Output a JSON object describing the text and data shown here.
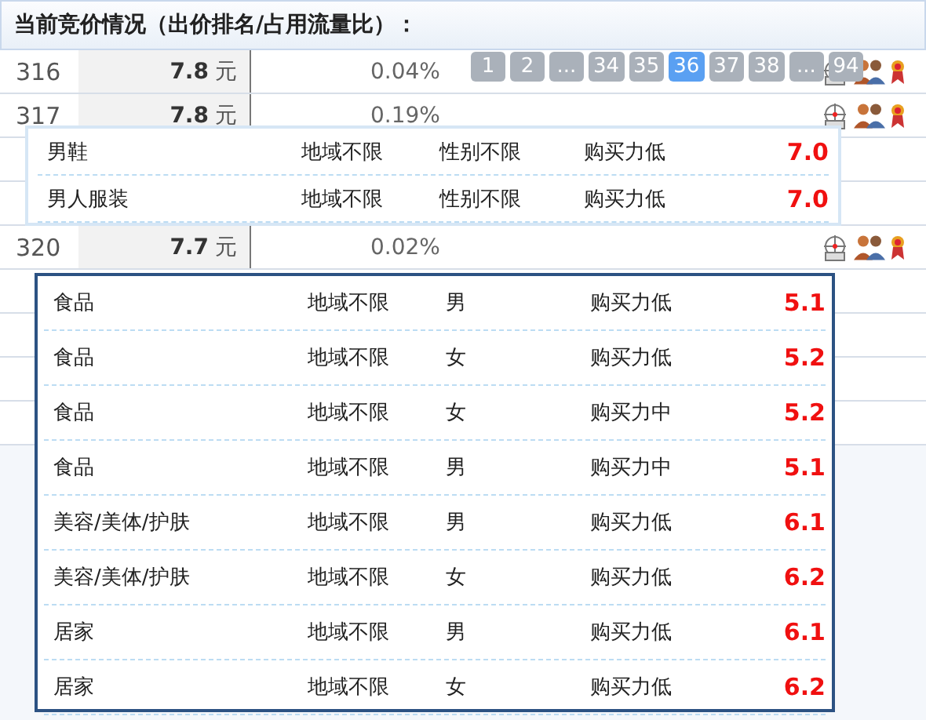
{
  "title": "当前竞价情况（出价排名/占用流量比）：",
  "rows": [
    {
      "rank": "316",
      "price": "7.8",
      "unit": "元",
      "share": "0.04%"
    },
    {
      "rank": "317",
      "price": "7.8",
      "unit": "元",
      "share": "0.19%"
    },
    {
      "rank": "320",
      "price": "7.7",
      "unit": "元",
      "share": "0.02%"
    }
  ],
  "pagination": [
    {
      "label": "1",
      "selected": false
    },
    {
      "label": "2",
      "selected": false
    },
    {
      "label": "...",
      "selected": false
    },
    {
      "label": "34",
      "selected": false
    },
    {
      "label": "35",
      "selected": false
    },
    {
      "label": "36",
      "selected": true
    },
    {
      "label": "37",
      "selected": false
    },
    {
      "label": "38",
      "selected": false
    },
    {
      "label": "...",
      "selected": false
    },
    {
      "label": "94",
      "selected": false
    }
  ],
  "popup_top": [
    {
      "category": "男鞋",
      "region": "地域不限",
      "gender": "性别不限",
      "power": "购买力低",
      "price": "7.0"
    },
    {
      "category": "男人服装",
      "region": "地域不限",
      "gender": "性别不限",
      "power": "购买力低",
      "price": "7.0"
    }
  ],
  "popup_main": [
    {
      "category": "食品",
      "region": "地域不限",
      "gender": "男",
      "power": "购买力低",
      "price": "5.1"
    },
    {
      "category": "食品",
      "region": "地域不限",
      "gender": "女",
      "power": "购买力低",
      "price": "5.2"
    },
    {
      "category": "食品",
      "region": "地域不限",
      "gender": "女",
      "power": "购买力中",
      "price": "5.2"
    },
    {
      "category": "食品",
      "region": "地域不限",
      "gender": "男",
      "power": "购买力中",
      "price": "5.1"
    },
    {
      "category": "美容/美体/护肤",
      "region": "地域不限",
      "gender": "男",
      "power": "购买力低",
      "price": "6.1"
    },
    {
      "category": "美容/美体/护肤",
      "region": "地域不限",
      "gender": "女",
      "power": "购买力低",
      "price": "6.2"
    },
    {
      "category": "居家",
      "region": "地域不限",
      "gender": "男",
      "power": "购买力低",
      "price": "6.1"
    },
    {
      "category": "居家",
      "region": "地域不限",
      "gender": "女",
      "power": "购买力低",
      "price": "6.2"
    }
  ]
}
